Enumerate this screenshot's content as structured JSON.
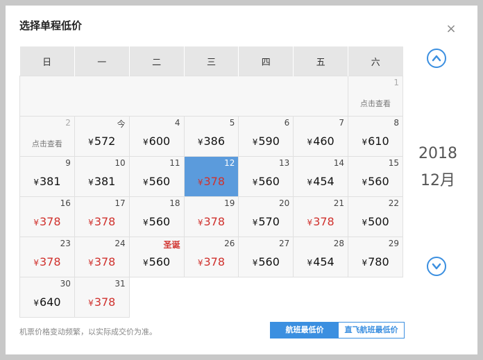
{
  "dialog": {
    "title": "选择单程低价",
    "close_label": "×"
  },
  "calendar": {
    "weekdays": [
      "日",
      "一",
      "二",
      "三",
      "四",
      "五",
      "六"
    ],
    "currency": "¥",
    "check_label": "点击查看",
    "weeks": [
      [
        null,
        null,
        null,
        null,
        null,
        null,
        {
          "day": "1",
          "grey": true,
          "check": true
        }
      ],
      [
        {
          "day": "2",
          "grey": true,
          "check": true
        },
        {
          "day": "今",
          "price": "572"
        },
        {
          "day": "4",
          "price": "600"
        },
        {
          "day": "5",
          "price": "386"
        },
        {
          "day": "6",
          "price": "590"
        },
        {
          "day": "7",
          "price": "460"
        },
        {
          "day": "8",
          "price": "610"
        }
      ],
      [
        {
          "day": "9",
          "price": "381"
        },
        {
          "day": "10",
          "price": "381"
        },
        {
          "day": "11",
          "price": "560"
        },
        {
          "day": "12",
          "price": "378",
          "low": true,
          "selected": true
        },
        {
          "day": "13",
          "price": "560"
        },
        {
          "day": "14",
          "price": "454"
        },
        {
          "day": "15",
          "price": "560"
        }
      ],
      [
        {
          "day": "16",
          "price": "378",
          "low": true
        },
        {
          "day": "17",
          "price": "378",
          "low": true
        },
        {
          "day": "18",
          "price": "560"
        },
        {
          "day": "19",
          "price": "378",
          "low": true
        },
        {
          "day": "20",
          "price": "570"
        },
        {
          "day": "21",
          "price": "378",
          "low": true
        },
        {
          "day": "22",
          "price": "500"
        }
      ],
      [
        {
          "day": "23",
          "price": "378",
          "low": true
        },
        {
          "day": "24",
          "price": "378",
          "low": true
        },
        {
          "day": "圣诞",
          "price": "560",
          "holiday": true
        },
        {
          "day": "26",
          "price": "378",
          "low": true
        },
        {
          "day": "27",
          "price": "560"
        },
        {
          "day": "28",
          "price": "454"
        },
        {
          "day": "29",
          "price": "780"
        }
      ],
      [
        {
          "day": "30",
          "price": "640"
        },
        {
          "day": "31",
          "price": "378",
          "low": true
        },
        "blank",
        "blank",
        "blank",
        "blank",
        "blank"
      ]
    ]
  },
  "nav": {
    "year": "2018",
    "month": "12月",
    "up_icon": "chevron-up-icon",
    "down_icon": "chevron-down-icon"
  },
  "footer": {
    "note": "机票价格变动频繁，以实际成交价为准。",
    "toggle_lowest": "航班最低价",
    "toggle_direct": "直飞航班最低价"
  },
  "colors": {
    "accent": "#3b8fe0",
    "selected": "#5b9bdc",
    "low_price": "#d0312d"
  }
}
